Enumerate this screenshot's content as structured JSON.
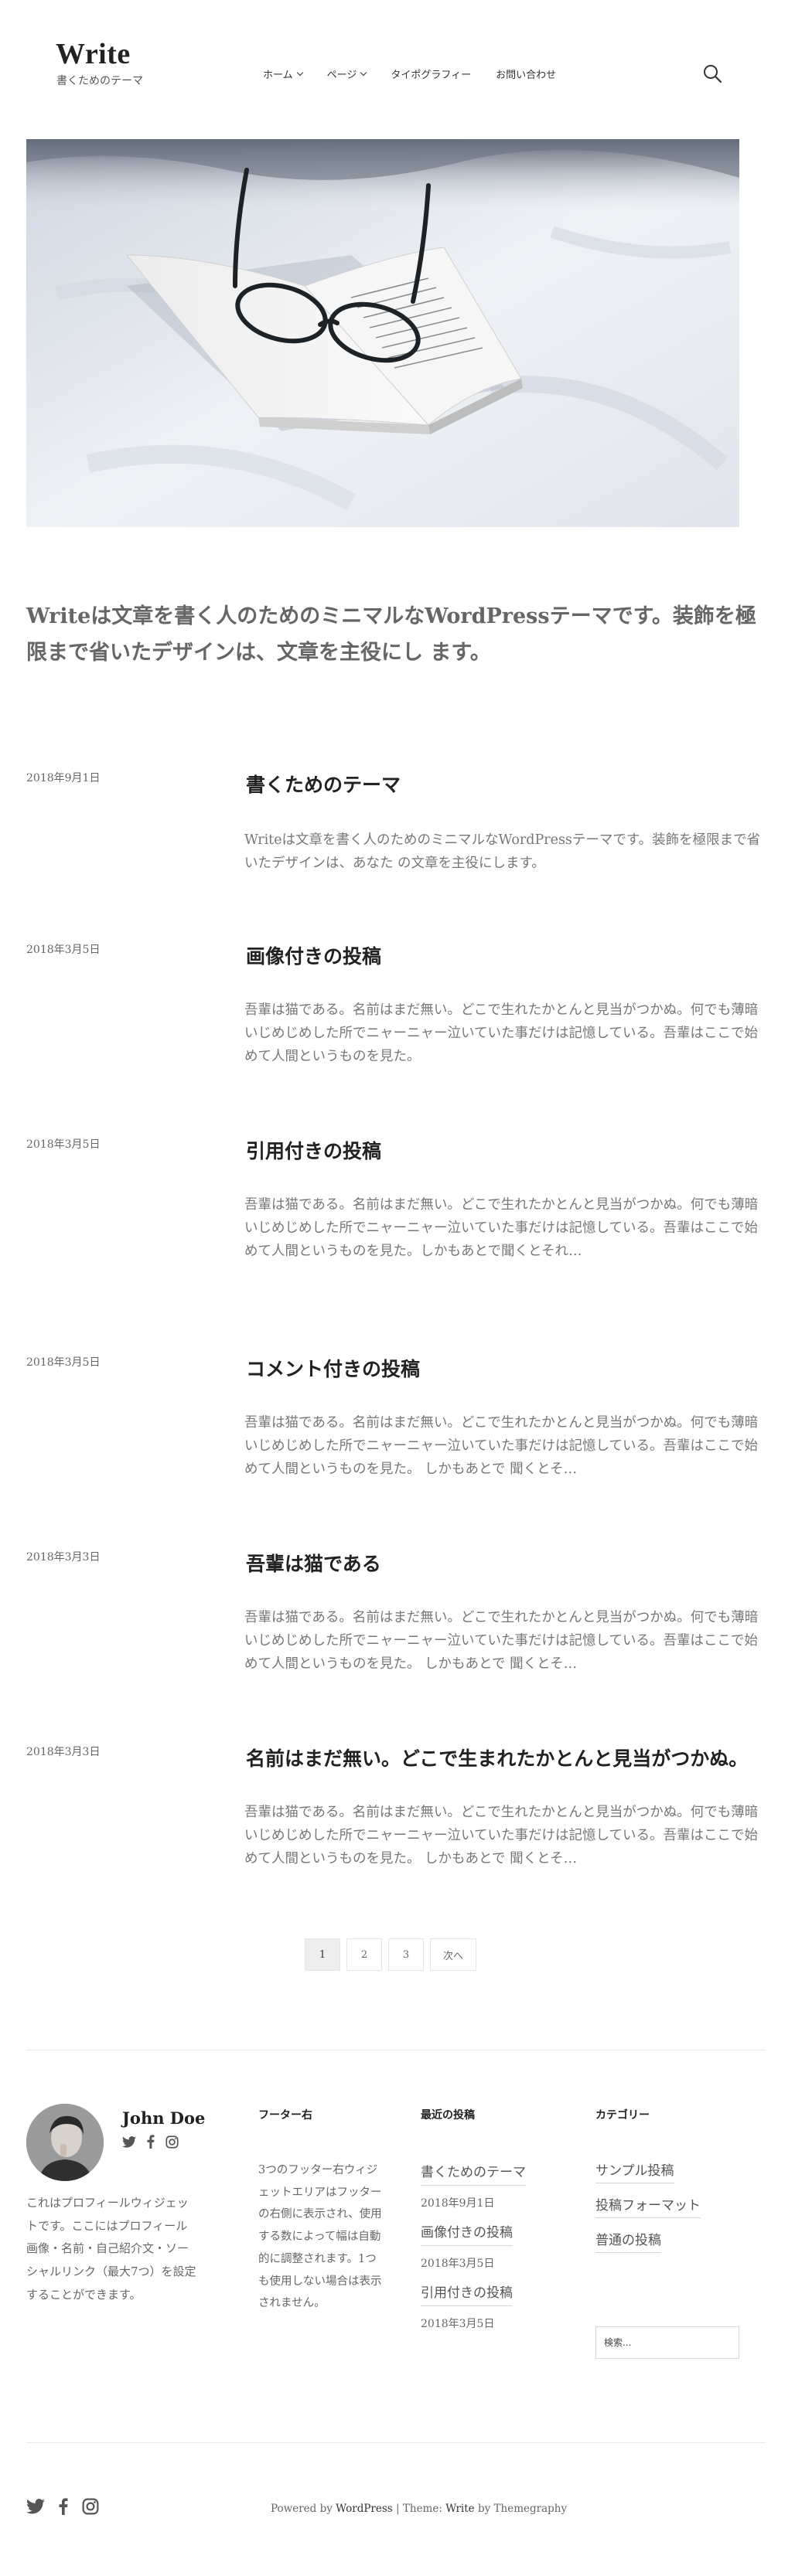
{
  "site": {
    "title": "Write",
    "tagline": "書くためのテーマ"
  },
  "nav": [
    {
      "label": "ホーム",
      "has_submenu": true
    },
    {
      "label": "ページ",
      "has_submenu": true
    },
    {
      "label": "タイポグラフィー",
      "has_submenu": false
    },
    {
      "label": "お問い合わせ",
      "has_submenu": false
    }
  ],
  "intro": "Writeは文章を書く人のためのミニマルなWordPressテーマです。装飾を極限まで省いたデザインは、文章を主役にし ます。",
  "posts": [
    {
      "date": "2018年9月1日",
      "title": "書くためのテーマ",
      "excerpt": "Writeは文章を書く人のためのミニマルなWordPressテーマです。装飾を極限まで省いたデザインは、あなた の文章を主役にします。"
    },
    {
      "date": "2018年3月5日",
      "title": "画像付きの投稿",
      "excerpt": "吾輩は猫である。名前はまだ無い。どこで生れたかとんと見当がつかぬ。何でも薄暗いじめじめした所でニャーニャー泣いていた事だけは記憶している。吾輩はここで始めて人間というものを見た。"
    },
    {
      "date": "2018年3月5日",
      "title": "引用付きの投稿",
      "excerpt": "吾輩は猫である。名前はまだ無い。どこで生れたかとんと見当がつかぬ。何でも薄暗いじめじめした所でニャーニャー泣いていた事だけは記憶している。吾輩はここで始めて人間というものを見た。しかもあとで聞くとそれ…"
    },
    {
      "date": "2018年3月5日",
      "title": "コメント付きの投稿",
      "excerpt": "吾輩は猫である。名前はまだ無い。どこで生れたかとんと見当がつかぬ。何でも薄暗いじめじめした所でニャーニャー泣いていた事だけは記憶している。吾輩はここで始めて人間というものを見た。 しかもあとで 聞くとそ…"
    },
    {
      "date": "2018年3月3日",
      "title": "吾輩は猫である",
      "excerpt": "吾輩は猫である。名前はまだ無い。どこで生れたかとんと見当がつかぬ。何でも薄暗いじめじめした所でニャーニャー泣いていた事だけは記憶している。吾輩はここで始めて人間というものを見た。 しかもあとで 聞くとそ…"
    },
    {
      "date": "2018年3月3日",
      "title": "名前はまだ無い。どこで生まれたかとんと見当がつかぬ。",
      "excerpt": "吾輩は猫である。名前はまだ無い。どこで生れたかとんと見当がつかぬ。何でも薄暗いじめじめした所でニャーニャー泣いていた事だけは記憶している。吾輩はここで始めて人間というものを見た。 しかもあとで 聞くとそ…"
    }
  ],
  "pagination": {
    "current": "1",
    "pages": [
      "1",
      "2",
      "3"
    ],
    "next_label": "次へ"
  },
  "footer": {
    "profile": {
      "name": "John Doe",
      "text": "これはプロフィールウィジェットです。ここにはプロフィール画像・名前・自己紹介文・ソーシャルリンク（最大7つ）を設定することができます。"
    },
    "widget2": {
      "title": "フーター右",
      "text": "3つのフッター右ウィジェットエリアはフッターの右側に表示され、使用する数によって幅は自動的に調整されます。1つも使用しない場合は表示されません。"
    },
    "recent": {
      "title": "最近の投稿",
      "items": [
        {
          "title": "書くためのテーマ",
          "date": "2018年9月1日"
        },
        {
          "title": "画像付きの投稿",
          "date": "2018年3月5日"
        },
        {
          "title": "引用付きの投稿",
          "date": "2018年3月5日"
        }
      ]
    },
    "categories": {
      "title": "カテゴリー",
      "items": [
        "サンプル投稿",
        "投稿フォーマット",
        "普通の投稿"
      ]
    },
    "search_placeholder": "検索...",
    "credits": {
      "prefix": "Powered by ",
      "wp": "WordPress",
      "sep": " | Theme: ",
      "theme": "Write",
      "by": " by Themegraphy"
    }
  },
  "icons": {
    "search": "search-icon",
    "social": [
      "twitter-icon",
      "facebook-icon",
      "instagram-icon"
    ]
  }
}
